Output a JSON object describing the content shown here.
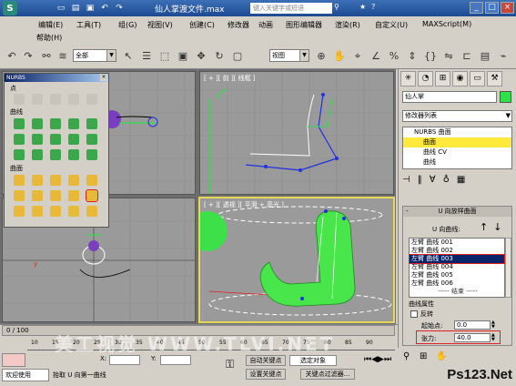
{
  "window": {
    "title": "仙人掌渡文件.max",
    "search_placeholder": "键入关键字或短语",
    "app_icon": "S"
  },
  "menu": {
    "items": [
      "编辑(E)",
      "工具(T)",
      "组(G)",
      "视图(V)",
      "创建(C)",
      "修改器",
      "动画",
      "图形编辑器",
      "渲染(R)",
      "自定义(U)",
      "MAXScript(M)",
      "帮助(H)"
    ]
  },
  "toolbar": {
    "selection_filter": "全部",
    "ref_coord": "视图"
  },
  "viewports": {
    "front_label": "[ + ][ 前 ][ 线框 ]",
    "persp_label": "[ + ][ 透视 ][ 平滑 + 高光 ]"
  },
  "nurbs_panel": {
    "title": "NURBS",
    "point_label": "点",
    "curve_label": "曲线",
    "surface_label": "曲面"
  },
  "command_panel": {
    "object_name": "仙人掌",
    "object_color": "#2ee04a",
    "modifier_list": "修改器列表",
    "stack": [
      "NURBS 曲面",
      "曲面",
      "曲线 CV",
      "曲线"
    ],
    "rollout_title": "U 向放样曲面",
    "u_curves_label": "U 向曲线:",
    "curves": [
      "左臂 曲线 001",
      "左臂 曲线 002",
      "左臂 曲线 003",
      "左臂 曲线 004",
      "左臂 曲线 005",
      "左臂 曲线 006",
      "----- 结束 -----"
    ],
    "selected_curve_index": 2,
    "curve_props_title": "曲线属性",
    "reverse_label": "反转",
    "start_point_label": "起始点:",
    "start_point_value": "0.0",
    "tension_label": "张力:",
    "tension_value": "40.0"
  },
  "bottom": {
    "frame_counter": "0 / 100",
    "ruler_ticks": [
      "10",
      "15",
      "20",
      "25",
      "30",
      "35",
      "40",
      "45",
      "50",
      "55",
      "60",
      "65",
      "70",
      "75",
      "80",
      "85",
      "90"
    ],
    "x_label": "X:",
    "y_label": "Y:",
    "welcome": "欢迎使用",
    "prompt": "抬取 U 向第一曲线",
    "autokey": "自动关键点",
    "select_obj": "选定对象",
    "setkey": "设置关键点",
    "key_filters": "关键点过滤器...",
    "watermark": "美工视觉 WWW.TLVI.NET",
    "brand": "Ps123.Net"
  }
}
